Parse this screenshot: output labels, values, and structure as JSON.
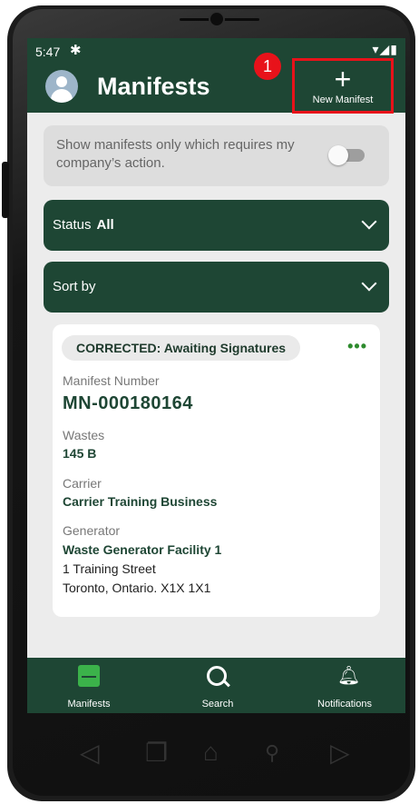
{
  "status_bar": {
    "time": "5:47",
    "icons": "▾◢▮"
  },
  "header": {
    "title": "Manifests",
    "new_button_label": "New Manifest",
    "new_button_symbol": "+",
    "annotation_number": "1"
  },
  "filter_toggle": {
    "label": "Show manifests only which requires my company’s action.",
    "enabled": false
  },
  "status_dropdown": {
    "label": "Status",
    "value": "All"
  },
  "sort_dropdown": {
    "label": "Sort by"
  },
  "manifest_card": {
    "status_pill": "CORRECTED: Awaiting Signatures",
    "menu_symbol": "•••",
    "manifest_number_label": "Manifest Number",
    "manifest_number": "MN-000180164",
    "wastes_label": "Wastes",
    "wastes_value": "145 B",
    "carrier_label": "Carrier",
    "carrier_value": "Carrier Training Business",
    "generator_label": "Generator",
    "generator_name": "Waste Generator Facility 1",
    "generator_street": "1 Training Street",
    "generator_city": "Toronto, Ontario. X1X 1X1"
  },
  "bottom_nav": [
    {
      "label": "Manifests",
      "icon": "inbox-icon",
      "active": true
    },
    {
      "label": "Search",
      "icon": "search-icon",
      "active": false
    },
    {
      "label": "Notifications",
      "icon": "bell-icon",
      "active": false
    }
  ],
  "colors": {
    "primary": "#1e4634",
    "accent": "#3bb24a",
    "highlight": "#e8121a",
    "background": "#ececec"
  }
}
